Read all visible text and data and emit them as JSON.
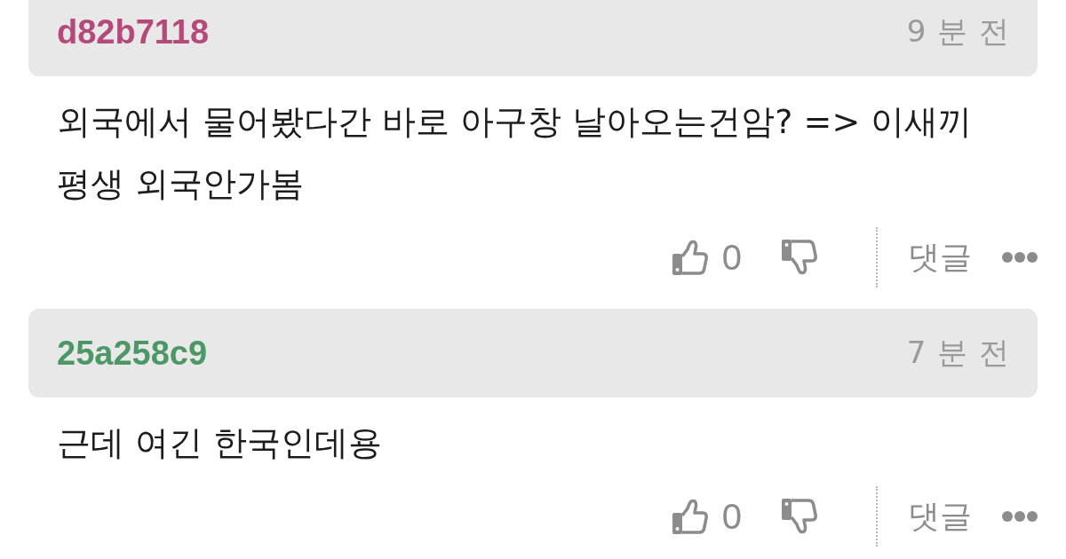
{
  "comments": [
    {
      "author": "d82b7118",
      "color": "#b4497a",
      "time": "9 분 전",
      "text": "외국에서 물어봤다간 바로 아구창 날아오는건암? => 이새끼 평생 외국안가봄",
      "likes": "0",
      "reply": "댓글"
    },
    {
      "author": "25a258c9",
      "color": "#4b9866",
      "time": "7 분 전",
      "text": "근데 여긴 한국인데용",
      "likes": "0",
      "reply": "댓글"
    }
  ]
}
